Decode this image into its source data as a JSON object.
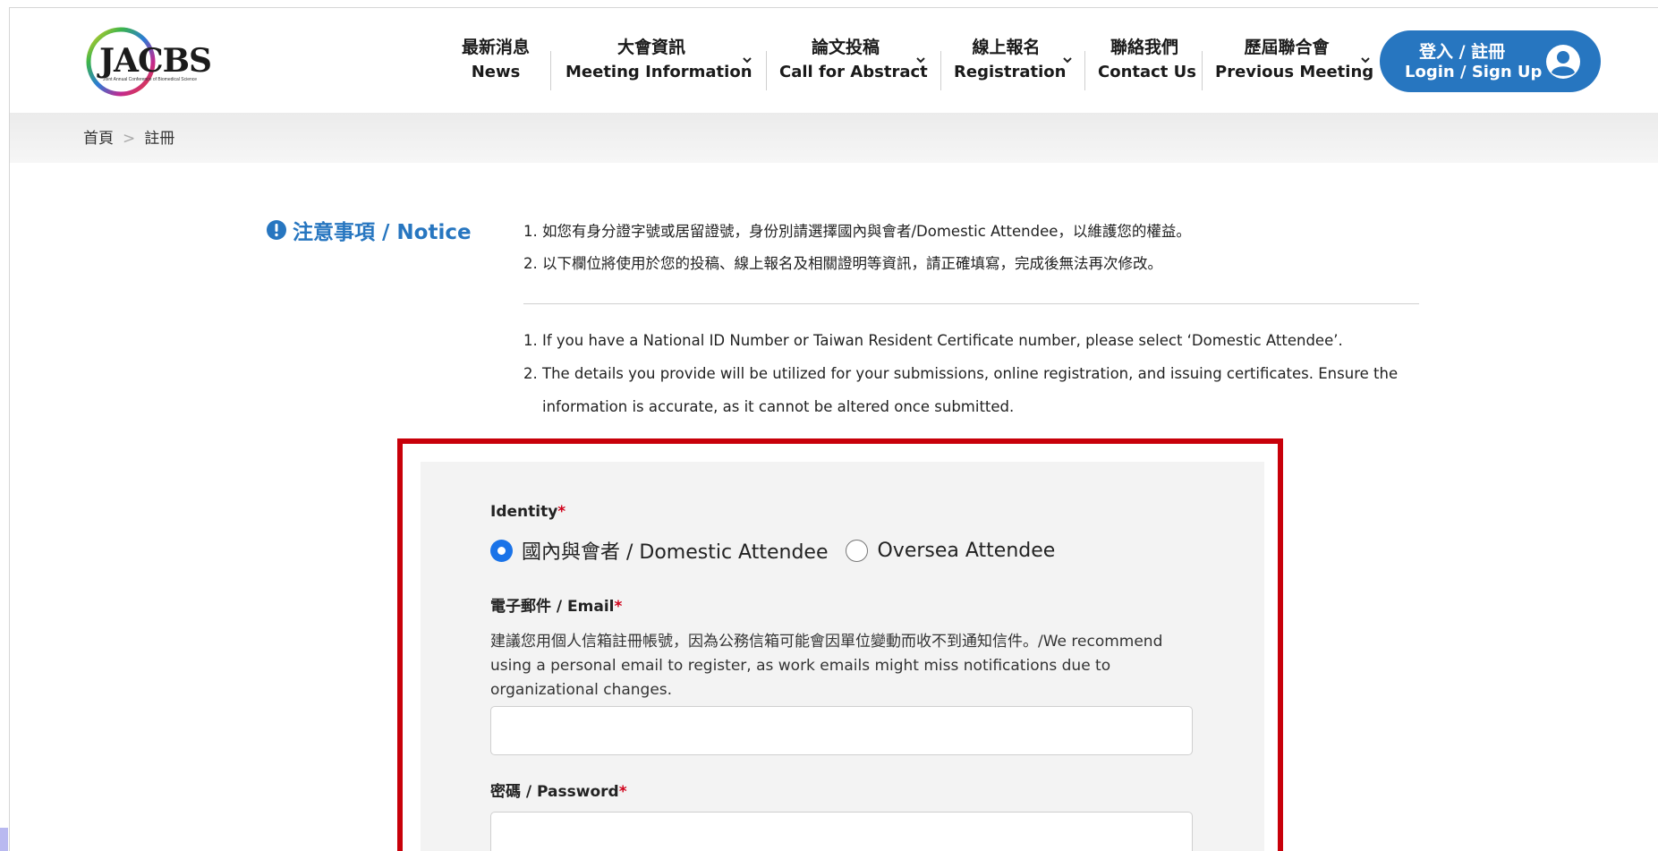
{
  "header": {
    "logo": {
      "text": "JACBS",
      "subtitle": "Joint Annual Conference of Biomedical Science"
    },
    "nav": [
      {
        "zh": "最新消息",
        "en": "News",
        "dropdown": false
      },
      {
        "zh": "大會資訊",
        "en": "Meeting Information",
        "dropdown": true
      },
      {
        "zh": "論文投稿",
        "en": "Call for Abstract",
        "dropdown": true
      },
      {
        "zh": "線上報名",
        "en": "Registration",
        "dropdown": true
      },
      {
        "zh": "聯絡我們",
        "en": "Contact Us",
        "dropdown": false
      },
      {
        "zh": "歷屆聯合會",
        "en": "Previous Meeting",
        "dropdown": true
      }
    ],
    "login": {
      "zh": "登入 / 註冊",
      "en": "Login / Sign Up"
    }
  },
  "breadcrumb": {
    "home": "首頁",
    "separator": ">",
    "current": "註冊"
  },
  "notice": {
    "title": "注意事項 / Notice",
    "zh_items": [
      {
        "num": "1.",
        "text": "如您有身分證字號或居留證號，身份別請選擇國內與會者/Domestic Attendee，以維護您的權益。"
      },
      {
        "num": "2.",
        "text": "以下欄位將使用於您的投稿、線上報名及相關證明等資訊，請正確填寫，完成後無法再次修改。"
      }
    ],
    "en_items": [
      {
        "num": "1.",
        "text": "If you have a National ID Number or Taiwan Resident Certificate number, please select ‘Domestic Attendee’."
      },
      {
        "num": "2.",
        "text": "The details you provide will be utilized for your submissions, online registration, and issuing certificates. Ensure the information is accurate, as it cannot be altered once submitted."
      }
    ]
  },
  "form": {
    "identity": {
      "label": "Identity",
      "required_mark": "*",
      "options": [
        {
          "label": "國內與會者 / Domestic Attendee",
          "selected": true
        },
        {
          "label": "Oversea Attendee",
          "selected": false
        }
      ]
    },
    "email": {
      "label": "電子郵件 / Email",
      "required_mark": "*",
      "helper": "建議您用個人信箱註冊帳號，因為公務信箱可能會因單位變動而收不到通知信件。/We recommend using a personal email to register, as work emails might miss notifications due to organizational changes.",
      "value": ""
    },
    "password": {
      "label": "密碼 / Password",
      "required_mark": "*",
      "value": ""
    }
  },
  "colors": {
    "accent": "#2776c0",
    "highlight_frame": "#c8000a",
    "radio_selected": "#1a73e8",
    "required": "#d0021b"
  }
}
